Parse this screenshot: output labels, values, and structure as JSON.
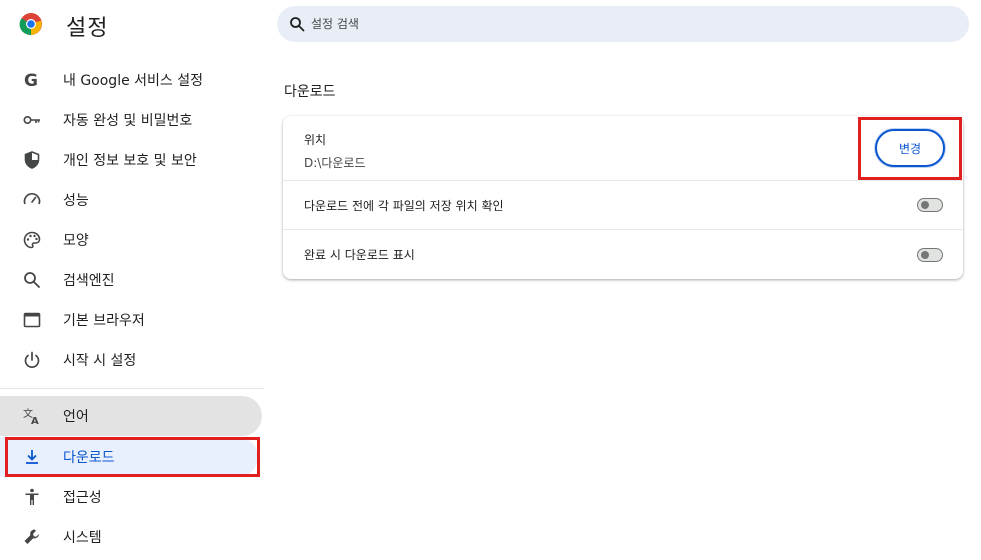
{
  "app": {
    "title": "설정"
  },
  "search": {
    "placeholder": "설정 검색"
  },
  "sidebar": {
    "items": [
      {
        "label": "내 Google 서비스 설정",
        "icon": "google-g-icon"
      },
      {
        "label": "자동 완성 및 비밀번호",
        "icon": "key-icon"
      },
      {
        "label": "개인 정보 보호 및 보안",
        "icon": "shield-icon"
      },
      {
        "label": "성능",
        "icon": "speedometer-icon"
      },
      {
        "label": "모양",
        "icon": "palette-icon"
      },
      {
        "label": "검색엔진",
        "icon": "search-icon"
      },
      {
        "label": "기본 브라우저",
        "icon": "browser-window-icon"
      },
      {
        "label": "시작 시 설정",
        "icon": "power-icon"
      },
      {
        "label": "언어",
        "icon": "translate-icon"
      },
      {
        "label": "다운로드",
        "icon": "download-icon"
      },
      {
        "label": "접근성",
        "icon": "accessibility-icon"
      },
      {
        "label": "시스템",
        "icon": "wrench-icon"
      }
    ],
    "active_index": 9,
    "hover_index": 8
  },
  "downloads": {
    "section_title": "다운로드",
    "location_label": "위치",
    "location_value": "D:\\다운로드",
    "change_button": "변경",
    "ask_label": "다운로드 전에 각 파일의 저장 위치 확인",
    "ask_enabled": false,
    "show_label": "완료 시 다운로드 표시",
    "show_enabled": false
  },
  "colors": {
    "accent": "#0b57d0",
    "highlight_box": "#e02020",
    "active_nav_bg": "#e8f0fe",
    "search_bg": "#e9eef6"
  }
}
